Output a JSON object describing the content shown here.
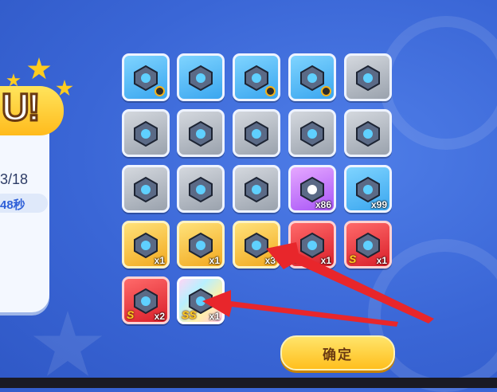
{
  "left_panel": {
    "banner_text": "U!",
    "progress": "3/18",
    "timer": "48秒"
  },
  "reward_grid": [
    {
      "quality": "blue",
      "icon": "wrist-armor-icon",
      "count": "",
      "has_dot": true,
      "rank": ""
    },
    {
      "quality": "blue",
      "icon": "boots-icon",
      "count": "",
      "has_dot": false,
      "rank": ""
    },
    {
      "quality": "blue",
      "icon": "infinity-amulet-icon",
      "count": "",
      "has_dot": true,
      "rank": ""
    },
    {
      "quality": "blue",
      "icon": "shield-disc-icon",
      "count": "",
      "has_dot": true,
      "rank": ""
    },
    {
      "quality": "grey",
      "icon": "helmet-icon",
      "count": "",
      "has_dot": false,
      "rank": ""
    },
    {
      "quality": "grey",
      "icon": "hood-armor-icon",
      "count": "",
      "has_dot": false,
      "rank": ""
    },
    {
      "quality": "grey",
      "icon": "ring-collar-icon",
      "count": "",
      "has_dot": false,
      "rank": ""
    },
    {
      "quality": "grey",
      "icon": "belt-band-icon",
      "count": "",
      "has_dot": false,
      "rank": ""
    },
    {
      "quality": "grey",
      "icon": "gauntlet-icon",
      "count": "",
      "has_dot": false,
      "rank": ""
    },
    {
      "quality": "grey",
      "icon": "gauntlet-icon",
      "count": "",
      "has_dot": false,
      "rank": ""
    },
    {
      "quality": "grey",
      "icon": "boots-icon",
      "count": "",
      "has_dot": false,
      "rank": ""
    },
    {
      "quality": "grey",
      "icon": "moon-necklace-icon",
      "count": "",
      "has_dot": false,
      "rank": ""
    },
    {
      "quality": "grey",
      "icon": "shield-disc-icon",
      "count": "",
      "has_dot": false,
      "rank": ""
    },
    {
      "quality": "purple",
      "icon": "crystal-cube-icon",
      "count": "x86",
      "has_dot": false,
      "rank": ""
    },
    {
      "quality": "blue",
      "icon": "gear-icon",
      "count": "x99",
      "has_dot": false,
      "rank": ""
    },
    {
      "quality": "gold",
      "icon": "mech-fist-icon",
      "count": "x1",
      "has_dot": false,
      "rank": ""
    },
    {
      "quality": "gold",
      "icon": "crest-emblem-icon",
      "count": "x1",
      "has_dot": false,
      "rank": ""
    },
    {
      "quality": "gold",
      "icon": "orb-core-icon",
      "count": "x3",
      "has_dot": false,
      "rank": ""
    },
    {
      "quality": "red",
      "icon": "cannon-icon",
      "count": "x1",
      "has_dot": false,
      "rank": "S"
    },
    {
      "quality": "red",
      "icon": "winged-badge-icon",
      "count": "x1",
      "has_dot": false,
      "rank": "S"
    },
    {
      "quality": "red",
      "icon": "gem-chip-icon",
      "count": "x2",
      "has_dot": false,
      "rank": "S"
    },
    {
      "quality": "rainbow",
      "icon": "winged-orb-icon",
      "count": "x1",
      "has_dot": false,
      "rank": "SS"
    }
  ],
  "confirm_button": {
    "label": "确定"
  },
  "colors": {
    "accent_gold": "#ffbf1d",
    "background": "#3a66d6",
    "arrow": "#e8262b"
  }
}
